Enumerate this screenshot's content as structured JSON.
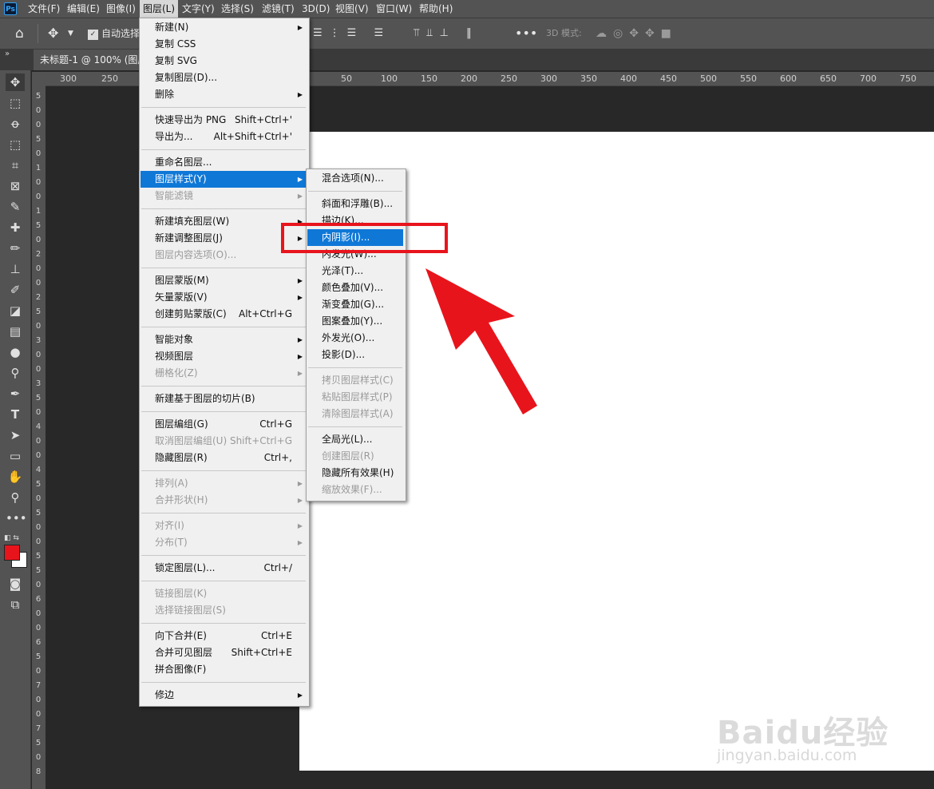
{
  "menubar": {
    "logo": "Ps",
    "items": [
      "文件(F)",
      "编辑(E)",
      "图像(I)",
      "图层(L)",
      "文字(Y)",
      "选择(S)",
      "滤镜(T)",
      "3D(D)",
      "视图(V)",
      "窗口(W)",
      "帮助(H)"
    ]
  },
  "options_bar": {
    "auto_select_label": "自动选择",
    "mode_3d_label": "3D 模式:"
  },
  "document_tab": {
    "title": "未标题-1 @ 100% (图层"
  },
  "ruler": {
    "h_labels": [
      "300",
      "250",
      "50",
      "100",
      "150",
      "200",
      "250",
      "300",
      "350",
      "400",
      "450",
      "500",
      "550",
      "600",
      "650",
      "700",
      "750"
    ],
    "v_labels": [
      "5",
      "0",
      "0",
      "5",
      "0",
      "1",
      "0",
      "0",
      "1",
      "5",
      "0",
      "2",
      "0",
      "0",
      "2",
      "5",
      "0",
      "3",
      "0",
      "0",
      "3",
      "5",
      "0",
      "4",
      "0",
      "0",
      "4",
      "5",
      "0",
      "5",
      "0",
      "0",
      "5",
      "5",
      "0",
      "6",
      "0",
      "0",
      "6",
      "5",
      "0",
      "7",
      "0",
      "0",
      "7",
      "5",
      "0",
      "8"
    ]
  },
  "layer_menu": {
    "items": [
      {
        "label": "新建(N)",
        "shortcut": "",
        "sub": true,
        "disabled": false
      },
      {
        "label": "复制 CSS",
        "shortcut": "",
        "sub": false,
        "disabled": false
      },
      {
        "label": "复制 SVG",
        "shortcut": "",
        "sub": false,
        "disabled": false
      },
      {
        "label": "复制图层(D)...",
        "shortcut": "",
        "sub": false,
        "disabled": false
      },
      {
        "label": "删除",
        "shortcut": "",
        "sub": true,
        "disabled": false
      },
      {
        "sep": true
      },
      {
        "label": "快速导出为 PNG",
        "shortcut": "Shift+Ctrl+'",
        "sub": false,
        "disabled": false
      },
      {
        "label": "导出为...",
        "shortcut": "Alt+Shift+Ctrl+'",
        "sub": false,
        "disabled": false
      },
      {
        "sep": true
      },
      {
        "label": "重命名图层...",
        "shortcut": "",
        "sub": false,
        "disabled": false
      },
      {
        "label": "图层样式(Y)",
        "shortcut": "",
        "sub": true,
        "disabled": false,
        "highlight": true
      },
      {
        "label": "智能滤镜",
        "shortcut": "",
        "sub": true,
        "disabled": true
      },
      {
        "sep": true
      },
      {
        "label": "新建填充图层(W)",
        "shortcut": "",
        "sub": true,
        "disabled": false
      },
      {
        "label": "新建调整图层(J)",
        "shortcut": "",
        "sub": true,
        "disabled": false
      },
      {
        "label": "图层内容选项(O)...",
        "shortcut": "",
        "sub": false,
        "disabled": true
      },
      {
        "sep": true
      },
      {
        "label": "图层蒙版(M)",
        "shortcut": "",
        "sub": true,
        "disabled": false
      },
      {
        "label": "矢量蒙版(V)",
        "shortcut": "",
        "sub": true,
        "disabled": false
      },
      {
        "label": "创建剪贴蒙版(C)",
        "shortcut": "Alt+Ctrl+G",
        "sub": false,
        "disabled": false
      },
      {
        "sep": true
      },
      {
        "label": "智能对象",
        "shortcut": "",
        "sub": true,
        "disabled": false
      },
      {
        "label": "视频图层",
        "shortcut": "",
        "sub": true,
        "disabled": false
      },
      {
        "label": "栅格化(Z)",
        "shortcut": "",
        "sub": true,
        "disabled": true
      },
      {
        "sep": true
      },
      {
        "label": "新建基于图层的切片(B)",
        "shortcut": "",
        "sub": false,
        "disabled": false
      },
      {
        "sep": true
      },
      {
        "label": "图层编组(G)",
        "shortcut": "Ctrl+G",
        "sub": false,
        "disabled": false
      },
      {
        "label": "取消图层编组(U)",
        "shortcut": "Shift+Ctrl+G",
        "sub": false,
        "disabled": true
      },
      {
        "label": "隐藏图层(R)",
        "shortcut": "Ctrl+,",
        "sub": false,
        "disabled": false
      },
      {
        "sep": true
      },
      {
        "label": "排列(A)",
        "shortcut": "",
        "sub": true,
        "disabled": true
      },
      {
        "label": "合并形状(H)",
        "shortcut": "",
        "sub": true,
        "disabled": true
      },
      {
        "sep": true
      },
      {
        "label": "对齐(I)",
        "shortcut": "",
        "sub": true,
        "disabled": true
      },
      {
        "label": "分布(T)",
        "shortcut": "",
        "sub": true,
        "disabled": true
      },
      {
        "sep": true
      },
      {
        "label": "锁定图层(L)...",
        "shortcut": "Ctrl+/",
        "sub": false,
        "disabled": false
      },
      {
        "sep": true
      },
      {
        "label": "链接图层(K)",
        "shortcut": "",
        "sub": false,
        "disabled": true
      },
      {
        "label": "选择链接图层(S)",
        "shortcut": "",
        "sub": false,
        "disabled": true
      },
      {
        "sep": true
      },
      {
        "label": "向下合并(E)",
        "shortcut": "Ctrl+E",
        "sub": false,
        "disabled": false
      },
      {
        "label": "合并可见图层",
        "shortcut": "Shift+Ctrl+E",
        "sub": false,
        "disabled": false
      },
      {
        "label": "拼合图像(F)",
        "shortcut": "",
        "sub": false,
        "disabled": false
      },
      {
        "sep": true
      },
      {
        "label": "修边",
        "shortcut": "",
        "sub": true,
        "disabled": false
      }
    ]
  },
  "style_submenu": {
    "items": [
      {
        "label": "混合选项(N)...",
        "disabled": false
      },
      {
        "sep": true
      },
      {
        "label": "斜面和浮雕(B)...",
        "disabled": false
      },
      {
        "label": "描边(K)...",
        "disabled": false
      },
      {
        "label": "内阴影(I)...",
        "disabled": false,
        "highlight": true
      },
      {
        "label": "内发光(W)...",
        "disabled": false
      },
      {
        "label": "光泽(T)...",
        "disabled": false
      },
      {
        "label": "颜色叠加(V)...",
        "disabled": false
      },
      {
        "label": "渐变叠加(G)...",
        "disabled": false
      },
      {
        "label": "图案叠加(Y)...",
        "disabled": false
      },
      {
        "label": "外发光(O)...",
        "disabled": false
      },
      {
        "label": "投影(D)...",
        "disabled": false
      },
      {
        "sep": true
      },
      {
        "label": "拷贝图层样式(C)",
        "disabled": true
      },
      {
        "label": "粘贴图层样式(P)",
        "disabled": true
      },
      {
        "label": "清除图层样式(A)",
        "disabled": true
      },
      {
        "sep": true
      },
      {
        "label": "全局光(L)...",
        "disabled": false
      },
      {
        "label": "创建图层(R)",
        "disabled": true
      },
      {
        "label": "隐藏所有效果(H)",
        "disabled": false
      },
      {
        "label": "缩放效果(F)...",
        "disabled": true
      }
    ]
  },
  "watermark": {
    "brand": "Baidu经验",
    "url": "jingyan.baidu.com"
  },
  "colors": {
    "highlight": "#0f78d7",
    "annotation_red": "#e8141c",
    "foreground_swatch": "#e8141c",
    "background_swatch": "#ffffff"
  },
  "tools": [
    "move-icon",
    "marquee-icon",
    "lasso-icon",
    "object-select-icon",
    "crop-icon",
    "frame-icon",
    "eyedropper-icon",
    "healing-icon",
    "brush-icon",
    "stamp-icon",
    "history-brush-icon",
    "eraser-icon",
    "gradient-icon",
    "blur-icon",
    "dodge-icon",
    "pen-icon",
    "type-icon",
    "path-select-icon",
    "rectangle-icon",
    "hand-icon",
    "zoom-icon",
    "more-icon"
  ]
}
